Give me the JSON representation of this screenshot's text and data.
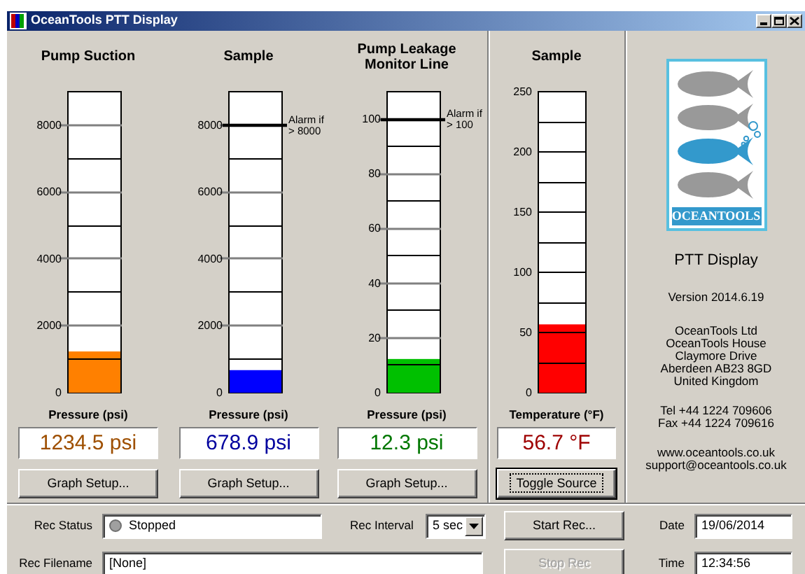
{
  "window": {
    "title": "OceanTools PTT Display"
  },
  "gauges": [
    {
      "kind": "pressure",
      "title": "Pump Suction",
      "ticks": [
        {
          "label": "8000",
          "alarm": false
        },
        {
          "label": "6000",
          "alarm": false
        },
        {
          "label": "4000",
          "alarm": false
        },
        {
          "label": "2000",
          "alarm": false
        },
        {
          "label": "0",
          "alarm": false
        }
      ],
      "level": 0.137,
      "color": "#ff8000",
      "caption": "Pressure (psi)",
      "reading": "1234.5 psi",
      "button": {
        "label": "Graph Setup...",
        "focused": false
      }
    },
    {
      "kind": "pressure",
      "title": "Sample",
      "ticks": [
        {
          "label": "8000",
          "alarm": true
        },
        {
          "label": "6000",
          "alarm": false
        },
        {
          "label": "4000",
          "alarm": false
        },
        {
          "label": "2000",
          "alarm": false
        },
        {
          "label": "0",
          "alarm": false
        }
      ],
      "alarm_label": "Alarm if > 8000",
      "level": 0.075,
      "color": "#0000ff",
      "caption": "Pressure (psi)",
      "reading": "678.9 psi",
      "button": {
        "label": "Graph Setup...",
        "focused": false
      }
    },
    {
      "kind": "pressure",
      "title": "Pump Leakage Monitor Line",
      "ticks": [
        {
          "label": "100",
          "alarm": true
        },
        {
          "label": "80",
          "alarm": false
        },
        {
          "label": "60",
          "alarm": false
        },
        {
          "label": "40",
          "alarm": false
        },
        {
          "label": "20",
          "alarm": false
        },
        {
          "label": "0",
          "alarm": false
        }
      ],
      "alarm_label": "Alarm if > 100",
      "level": 0.112,
      "color": "#00c000",
      "caption": "Pressure (psi)",
      "reading": "12.3 psi",
      "button": {
        "label": "Graph Setup...",
        "focused": false
      }
    },
    {
      "kind": "temperature",
      "title": "Sample",
      "ticks": [
        {
          "label": "250",
          "alarm": false
        },
        {
          "label": "200",
          "alarm": false
        },
        {
          "label": "150",
          "alarm": false
        },
        {
          "label": "100",
          "alarm": false
        },
        {
          "label": "50",
          "alarm": false
        },
        {
          "label": "0",
          "alarm": false
        }
      ],
      "level": 0.227,
      "color": "#ff0000",
      "caption": "Temperature (°F)",
      "reading": "56.7 °F",
      "button": {
        "label": "Toggle Source",
        "focused": true
      }
    }
  ],
  "info": {
    "logo_text": "OCEANTOOLS",
    "product": "PTT Display",
    "version": "Version 2014.6.19",
    "address": [
      "OceanTools Ltd",
      "OceanTools House",
      "Claymore Drive",
      "Aberdeen  AB23 8GD",
      "United Kingdom"
    ],
    "phone": [
      "Tel +44 1224 709606",
      "Fax +44 1224 709616"
    ],
    "web": [
      "www.oceantools.co.uk",
      "support@oceantools.co.uk"
    ]
  },
  "recording": {
    "status_label": "Rec Status",
    "status": {
      "text": "Stopped",
      "running": false
    },
    "interval_label": "Rec Interval",
    "interval": "5 sec",
    "filename_label": "Rec Filename",
    "filename": "[None]",
    "buttons": [
      {
        "label": "Start Rec...",
        "disabled": false
      },
      {
        "label": "Stop Rec",
        "disabled": true
      }
    ],
    "date_label": "Date",
    "date": "19/06/2014",
    "time_label": "Time",
    "time": "12:34:56"
  }
}
